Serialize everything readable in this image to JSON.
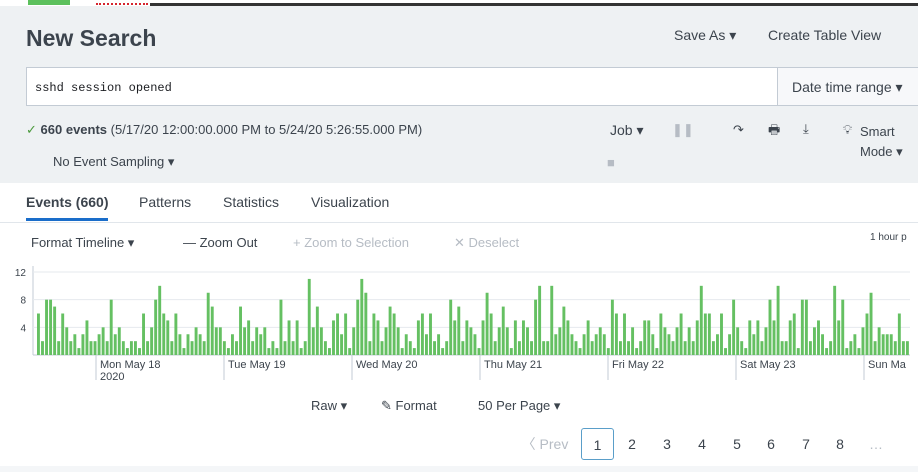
{
  "header": {
    "title": "New Search",
    "save_as": "Save As ▾",
    "create_table_view": "Create Table View"
  },
  "search": {
    "query": "sshd session opened",
    "date_range": "Date time range ▾"
  },
  "status": {
    "check": "✓",
    "events": "660 events",
    "range": "(5/17/20 12:00:00.000 PM to 5/24/20 5:26:55.000 PM)",
    "sampling": "No Event Sampling ▾"
  },
  "job": {
    "label": "Job ▾",
    "smart_line1": "Smart",
    "smart_line2": "Mode ▾"
  },
  "tabs": [
    {
      "label": "Events (660)"
    },
    {
      "label": "Patterns"
    },
    {
      "label": "Statistics"
    },
    {
      "label": "Visualization"
    }
  ],
  "timeline": {
    "format": "Format Timeline ▾",
    "zoom_out": "— Zoom Out",
    "zoom_selection": "+ Zoom to Selection",
    "deselect": "✕ Deselect",
    "bucket": "1 hour p"
  },
  "chart_data": {
    "type": "bar",
    "y_ticks": [
      "12",
      "8",
      "4"
    ],
    "ylim": [
      0,
      12
    ],
    "x_labels": [
      {
        "line1": "Mon May 18",
        "line2": "2020"
      },
      {
        "line1": "Tue May 19",
        "line2": ""
      },
      {
        "line1": "Wed May 20",
        "line2": ""
      },
      {
        "line1": "Thu May 21",
        "line2": ""
      },
      {
        "line1": "Fri May 22",
        "line2": ""
      },
      {
        "line1": "Sat May 23",
        "line2": ""
      },
      {
        "line1": "Sun Ma",
        "line2": ""
      }
    ],
    "values": [
      6,
      2,
      8,
      8,
      7,
      2,
      6,
      4,
      2,
      3,
      1,
      3,
      5,
      2,
      2,
      3,
      4,
      2,
      8,
      3,
      4,
      2,
      1,
      2,
      2,
      1,
      6,
      2,
      4,
      8,
      10,
      6,
      5,
      2,
      6,
      3,
      1,
      3,
      2,
      4,
      3,
      2,
      9,
      7,
      4,
      4,
      2,
      1,
      3,
      2,
      7,
      4,
      5,
      2,
      4,
      3,
      4,
      1,
      2,
      1,
      8,
      2,
      5,
      2,
      5,
      1,
      2,
      11,
      4,
      7,
      4,
      2,
      1,
      5,
      6,
      3,
      6,
      1,
      4,
      8,
      11,
      9,
      2,
      6,
      5,
      2,
      4,
      7,
      6,
      4,
      1,
      3,
      2,
      1,
      5,
      6,
      3,
      6,
      2,
      3,
      1,
      2,
      8,
      5,
      7,
      2,
      5,
      4,
      3,
      1,
      5,
      9,
      6,
      2,
      4,
      7,
      4,
      1,
      5,
      2,
      5,
      4,
      2,
      8,
      10,
      2,
      2,
      10,
      3,
      4,
      7,
      5,
      3,
      2,
      1,
      3,
      5,
      2,
      3,
      4,
      3,
      1,
      8,
      6,
      2,
      6,
      2,
      4,
      1,
      2,
      5,
      5,
      3,
      1,
      6,
      4,
      3,
      2,
      4,
      6,
      2,
      4,
      2,
      5,
      10,
      6,
      6,
      2,
      3,
      6,
      1,
      3,
      8,
      4,
      2,
      1,
      5,
      3,
      5,
      2,
      4,
      8,
      5,
      10,
      2,
      2,
      5,
      6,
      1,
      8,
      8,
      2,
      4,
      5,
      3,
      1,
      2,
      10,
      5,
      8,
      1,
      2,
      3,
      1,
      4,
      6,
      9,
      2,
      4,
      3,
      3,
      3,
      2,
      6,
      2,
      2
    ],
    "bar_color": "#65c062"
  },
  "footer": {
    "raw": "Raw ▾",
    "format": "Format",
    "per_page": "50 Per Page ▾",
    "prev": "〈 Prev",
    "pages": [
      "1",
      "2",
      "3",
      "4",
      "5",
      "6",
      "7",
      "8",
      "…"
    ],
    "current_page": "1"
  }
}
